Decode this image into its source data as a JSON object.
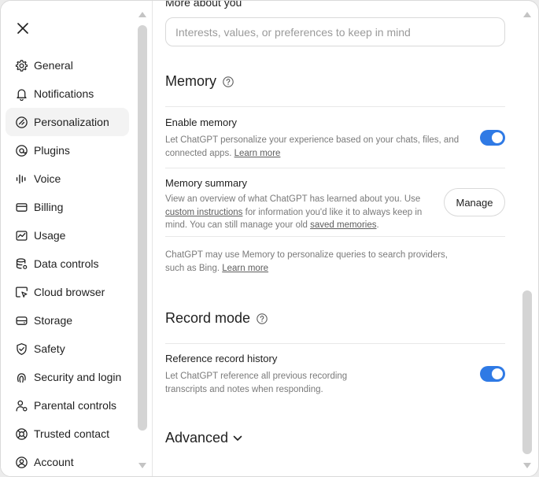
{
  "sidebar": {
    "close_icon": "close-icon",
    "items": [
      {
        "label": "General",
        "icon": "gear-icon"
      },
      {
        "label": "Notifications",
        "icon": "bell-icon"
      },
      {
        "label": "Personalization",
        "icon": "personalization-icon",
        "active": true
      },
      {
        "label": "Plugins",
        "icon": "plugins-icon"
      },
      {
        "label": "Voice",
        "icon": "voice-icon"
      },
      {
        "label": "Billing",
        "icon": "billing-icon"
      },
      {
        "label": "Usage",
        "icon": "usage-icon"
      },
      {
        "label": "Data controls",
        "icon": "data-controls-icon"
      },
      {
        "label": "Cloud browser",
        "icon": "cloud-browser-icon"
      },
      {
        "label": "Storage",
        "icon": "storage-icon"
      },
      {
        "label": "Safety",
        "icon": "shield-icon"
      },
      {
        "label": "Security and login",
        "icon": "fingerprint-icon"
      },
      {
        "label": "Parental controls",
        "icon": "parental-controls-icon"
      },
      {
        "label": "Trusted contact",
        "icon": "lifebuoy-icon"
      },
      {
        "label": "Account",
        "icon": "account-icon"
      }
    ]
  },
  "main": {
    "more_about_you": {
      "label": "More about you",
      "placeholder": "Interests, values, or preferences to keep in mind",
      "value": ""
    },
    "memory": {
      "title": "Memory",
      "enable": {
        "title": "Enable memory",
        "desc": "Let ChatGPT personalize your experience based on your chats, files, and connected apps.",
        "link": "Learn more",
        "enabled": true
      },
      "summary": {
        "title": "Memory summary",
        "desc_1": "View an overview of what ChatGPT has learned about you. Use",
        "link_1": "custom instructions",
        "desc_2": "for information you'd like it to always keep in mind. You can still manage your old",
        "link_2": "saved memories",
        "desc_3": ".",
        "button": "Manage"
      },
      "note": {
        "text": "ChatGPT may use Memory to personalize queries to search providers, such as Bing.",
        "link": "Learn more"
      }
    },
    "record_mode": {
      "title": "Record mode",
      "reference": {
        "title": "Reference record history",
        "desc": "Let ChatGPT reference all previous recording transcripts and notes when responding.",
        "enabled": true
      }
    },
    "advanced": {
      "title": "Advanced"
    }
  },
  "colors": {
    "accent": "#2f7ae5",
    "active_bg": "#f3f3f3",
    "muted_text": "#7a7a7a"
  }
}
